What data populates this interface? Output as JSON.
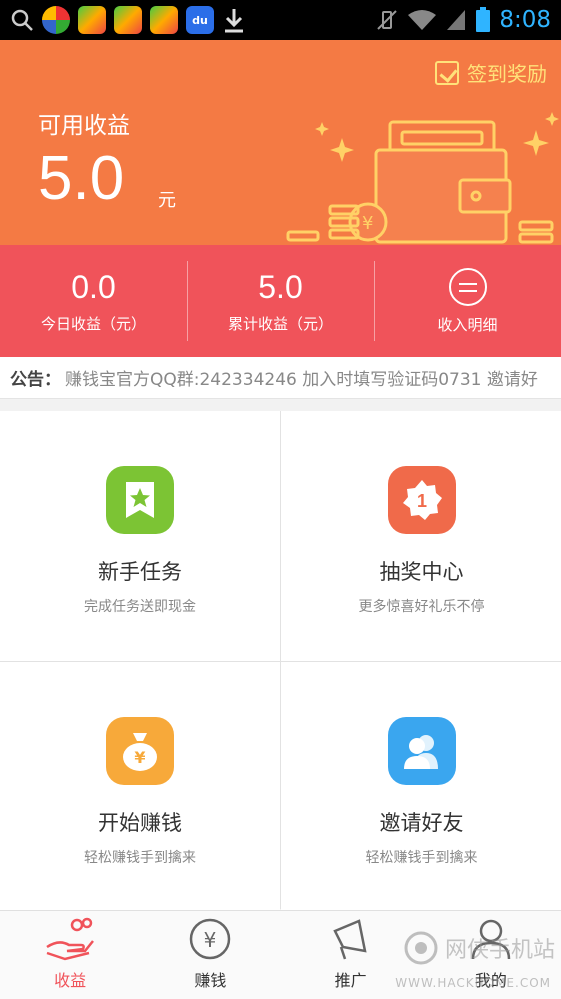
{
  "status_bar": {
    "time": "8:08",
    "app_icons": [
      "search-icon",
      "app-icon-1",
      "app-icon-2",
      "app-icon-3",
      "app-icon-4",
      "baidu-icon",
      "download-icon"
    ]
  },
  "header": {
    "signin_label": "签到奖励",
    "available_label": "可用收益",
    "available_value": "5.0",
    "available_unit": "元"
  },
  "stats": [
    {
      "value": "0.0",
      "label": "今日收益（元）"
    },
    {
      "value": "5.0",
      "label": "累计收益（元）"
    },
    {
      "label": "收入明细"
    }
  ],
  "notice": {
    "label": "公告：",
    "text": "赚钱宝官方QQ群:242334246 加入时填写验证码0731 邀请好"
  },
  "grid": [
    {
      "title": "新手任务",
      "subtitle": "完成任务送即现金",
      "color": "#7cc434",
      "icon": "bookmark-star-icon"
    },
    {
      "title": "抽奖中心",
      "subtitle": "更多惊喜好礼乐不停",
      "color": "#f06a4a",
      "icon": "badge-number-icon"
    },
    {
      "title": "开始赚钱",
      "subtitle": "轻松赚钱手到擒来",
      "color": "#f7a93a",
      "icon": "money-bag-icon"
    },
    {
      "title": "邀请好友",
      "subtitle": "轻松赚钱手到擒来",
      "color": "#3aa6ef",
      "icon": "friends-icon"
    }
  ],
  "bottom_nav": [
    {
      "label": "收益",
      "active": true
    },
    {
      "label": "赚钱",
      "active": false
    },
    {
      "label": "推广",
      "active": false
    },
    {
      "label": "我的",
      "active": false
    }
  ],
  "watermark": {
    "text": "网侠手机站",
    "url": "WWW.HACKHOME.COM"
  },
  "colors": {
    "header": "#f47a44",
    "stats": "#f0535a",
    "accent_yellow": "#ffe27a"
  }
}
